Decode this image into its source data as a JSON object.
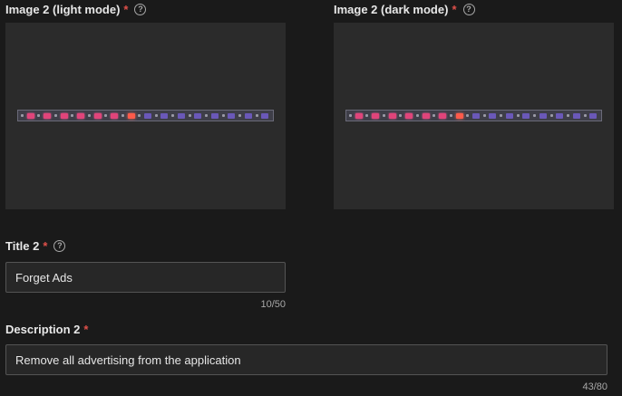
{
  "image_light": {
    "label": "Image 2 (light mode)",
    "required": "*",
    "help": "?"
  },
  "image_dark": {
    "label": "Image 2 (dark mode)",
    "required": "*",
    "help": "?"
  },
  "title": {
    "label": "Title 2",
    "required": "*",
    "help": "?",
    "value": "Forget Ads",
    "counter": "10/50"
  },
  "description": {
    "label": "Description 2",
    "required": "*",
    "value": "Remove all advertising from the application",
    "counter": "43/80"
  },
  "strip_cells": [
    "pink",
    "pink",
    "pink",
    "pink",
    "pink",
    "pink",
    "red",
    "purple",
    "purple",
    "purple",
    "purple",
    "purple",
    "purple",
    "purple",
    "purple"
  ],
  "colors": {
    "accent_required": "#e0504a",
    "pink": "#e0447a",
    "red": "#ff5a4a",
    "purple": "#6a58b8"
  }
}
